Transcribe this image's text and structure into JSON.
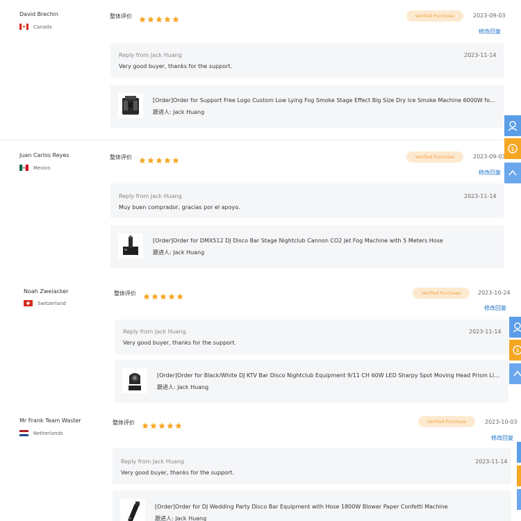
{
  "colors": {
    "star": "#f5a623",
    "verified_bg": "#fde9cf",
    "verified_text": "#f0a243",
    "link": "#1a73c8",
    "panel_bg": "#f5f6f8",
    "side_blue": "#5b9de6",
    "side_orange": "#f5a623"
  },
  "labels": {
    "rating": "整体评价",
    "verified": "Verified Purchase",
    "edit_reply": "修改回复",
    "follower_prefix": "跟进人: "
  },
  "reviews": [
    {
      "name": "David Brechin",
      "country": "Canada",
      "flag_icon": "canada-flag-icon",
      "stars": 5,
      "review_date": "2023-09-03",
      "reply_from": "Reply from Jack Huang",
      "reply_date": "2023-11-14",
      "reply_text": "Very good buyer, thanks for the support.",
      "order_title": "[Order]Order for Support Free Logo Custom Low Lying Fog Smoke Stage Effect Big Size Dry Ice Smoke Machine 6000W for ...",
      "follower": "跟进人: Jack Huang",
      "product_icon": "smoke-machine-icon"
    },
    {
      "name": "Juan Carlos Reyes",
      "country": "Mexico",
      "flag_icon": "mexico-flag-icon",
      "stars": 5,
      "review_date": "2023-09-03",
      "reply_from": "Reply from Jack Huang",
      "reply_date": "2023-11-14",
      "reply_text": "Muy buen comprador, gracias por el apoyo.",
      "order_title": "[Order]Order for DMX512 DJ Disco Bar Stage Nightclub Cannon CO2 Jet Fog Machine with 5 Meters Hose",
      "follower": "跟进人: Jack Huang",
      "product_icon": "co2-jet-machine-icon"
    },
    {
      "name": "Noah Zweiacker",
      "country": "Switzerland",
      "flag_icon": "switzerland-flag-icon",
      "stars": 5,
      "review_date": "2023-10-24",
      "reply_from": "Reply from Jack Huang",
      "reply_date": "2023-11-14",
      "reply_text": "Very good buyer, thanks for the support.",
      "order_title": "[Order]Order for Black/White DJ KTV Bar Disco Nightclub Equipment 9/11 CH 60W LED Sharpy Spot Moving Head Prism Light",
      "follower": "跟进人: Jack Huang",
      "product_icon": "moving-head-light-icon"
    },
    {
      "name": "Mr Frank Team Waster",
      "country": "Netherlands",
      "flag_icon": "netherlands-flag-icon",
      "stars": 5,
      "review_date": "2023-10-03",
      "reply_from": "Reply from Jack Huang",
      "reply_date": "2023-11-14",
      "reply_text": "Very good buyer, thanks for the support.",
      "order_title": "[Order]Order for DJ Wedding Party Disco Bar Equipment with Hose 1800W Blower Paper Confetti Machine",
      "follower": "跟进人: Jack Huang",
      "product_icon": "confetti-blower-icon"
    }
  ],
  "side_toolbar": {
    "icons": [
      "customer-service-icon",
      "support-agent-icon",
      "back-to-top-icon"
    ]
  }
}
